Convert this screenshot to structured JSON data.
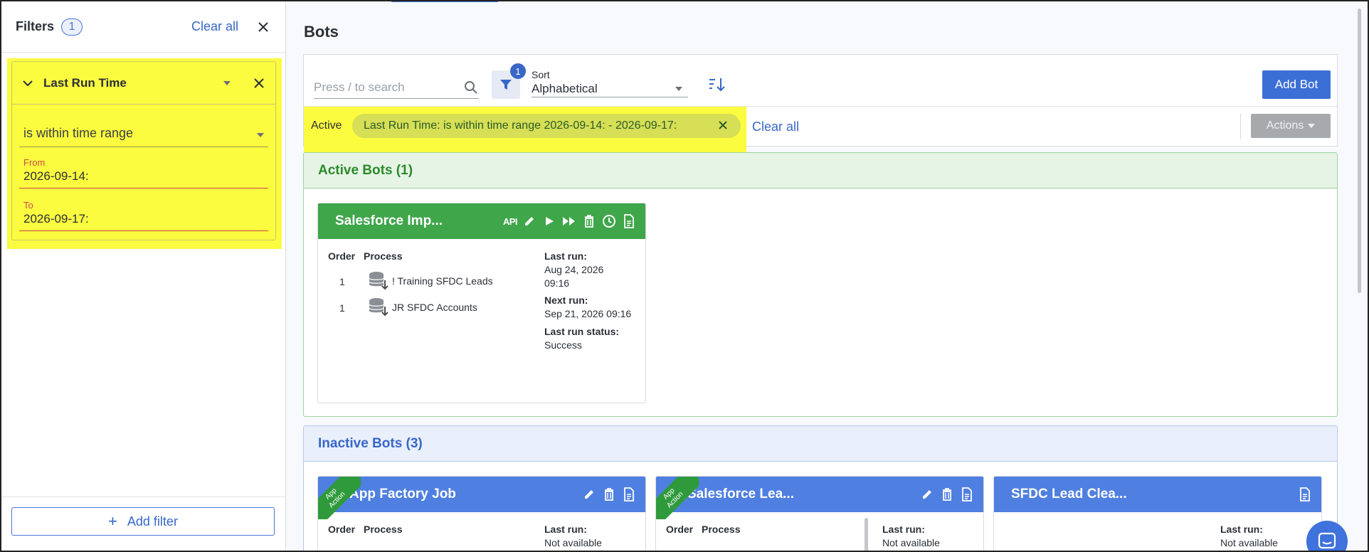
{
  "filters": {
    "title": "Filters",
    "count": "1",
    "clear_all": "Clear all",
    "block": {
      "title": "Last Run Time",
      "operator": "is within time range",
      "from_label": "From",
      "from_value": "2026-09-14:",
      "to_label": "To",
      "to_value": "2026-09-17:"
    },
    "add_filter": "Add filter"
  },
  "main": {
    "title": "Bots",
    "search_placeholder": "Press / to search",
    "filter_badge": "1",
    "sort_label": "Sort",
    "sort_value": "Alphabetical",
    "add_bot": "Add Bot",
    "active_label": "Active",
    "active_chip": "Last Run Time: is within time range 2026-09-14: - 2026-09-17:",
    "clear_all": "Clear all",
    "actions": "Actions"
  },
  "active_section": {
    "title": "Active Bots (1)",
    "bot": {
      "name": "Salesforce Imp...",
      "api_label": "API",
      "col_order": "Order",
      "col_process": "Process",
      "processes": [
        {
          "order": "1",
          "name": "! Training SFDC Leads"
        },
        {
          "order": "1",
          "name": "JR SFDC Accounts"
        }
      ],
      "last_run_label": "Last run:",
      "last_run_value_1": "Aug 24, 2026",
      "last_run_value_2": "09:16",
      "next_run_label": "Next run:",
      "next_run_value": "Sep 21, 2026 09:16",
      "status_label": "Last run status:",
      "status_value": "Success"
    }
  },
  "inactive_section": {
    "title": "Inactive Bots (3)",
    "bots": [
      {
        "name": "App Factory Job",
        "ribbon_1": "App",
        "ribbon_2": "Action",
        "col_order": "Order",
        "col_process": "Process",
        "last_run_label": "Last run:",
        "last_run_value": "Not available"
      },
      {
        "name": "Salesforce Lea...",
        "ribbon_1": "App",
        "ribbon_2": "Action",
        "col_order": "Order",
        "col_process": "Process",
        "last_run_label": "Last run:",
        "last_run_value": "Not available"
      },
      {
        "name": "SFDC Lead Clea...",
        "last_run_label": "Last run:",
        "last_run_value": "Not available"
      }
    ]
  },
  "colors": {
    "highlight": "#fbfb3f",
    "active_green": "#3fa64a",
    "inactive_blue": "#4f7fe0",
    "link_blue": "#3867c8"
  }
}
